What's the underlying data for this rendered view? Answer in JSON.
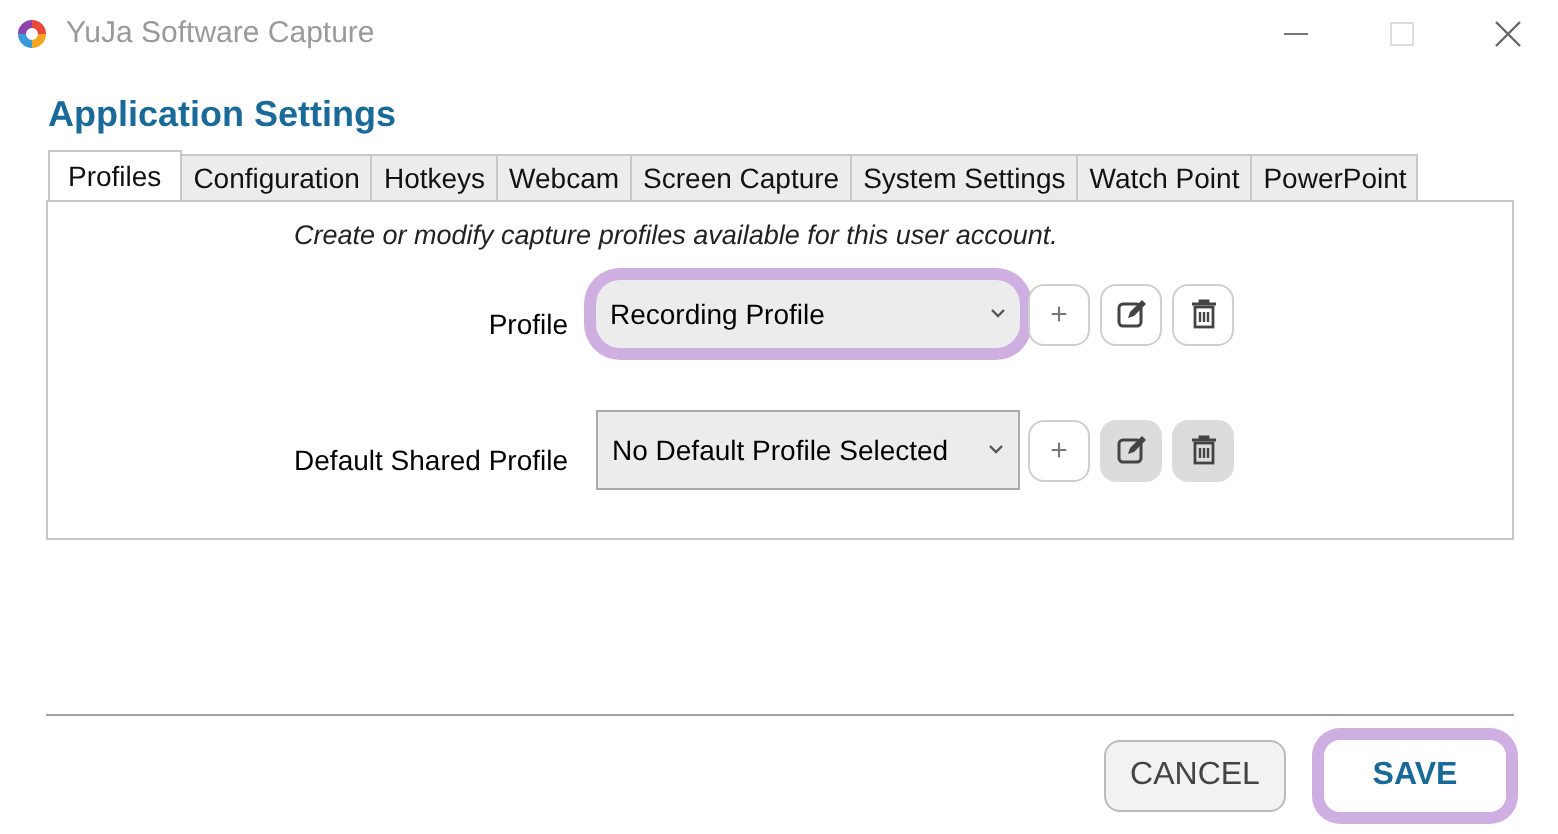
{
  "window": {
    "title": "YuJa Software Capture"
  },
  "heading": "Application Settings",
  "tabs": [
    {
      "label": "Profiles",
      "selected": true
    },
    {
      "label": "Configuration",
      "selected": false
    },
    {
      "label": "Hotkeys",
      "selected": false
    },
    {
      "label": "Webcam",
      "selected": false
    },
    {
      "label": "Screen Capture",
      "selected": false
    },
    {
      "label": "System Settings",
      "selected": false
    },
    {
      "label": "Watch Point",
      "selected": false
    },
    {
      "label": "PowerPoint",
      "selected": false
    }
  ],
  "description": "Create or modify capture profiles available for this user account.",
  "rows": [
    {
      "label": "Profile",
      "value": "Recording Profile",
      "highlighted": true,
      "add_button": "+",
      "edit_disabled": false,
      "delete_disabled": false
    },
    {
      "label": "Default Shared Profile",
      "value": "No Default Profile Selected",
      "highlighted": false,
      "add_button": "+",
      "edit_disabled": true,
      "delete_disabled": true
    }
  ],
  "buttons": [
    {
      "label": "CANCEL",
      "kind": "secondary",
      "highlighted": false
    },
    {
      "label": "SAVE",
      "kind": "primary",
      "highlighted": true
    }
  ]
}
